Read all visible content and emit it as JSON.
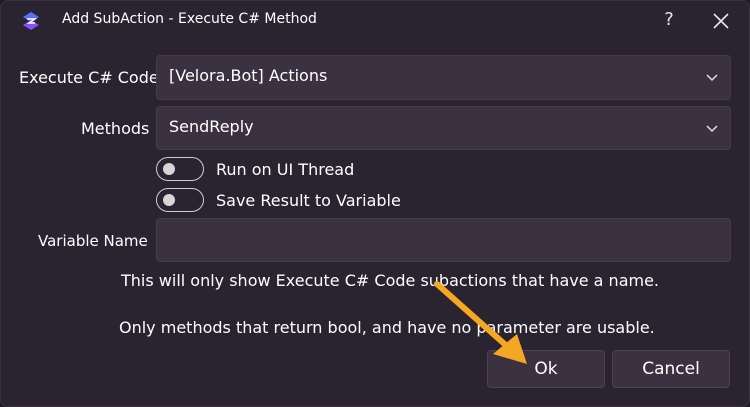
{
  "window": {
    "title": "Add SubAction - Execute C# Method",
    "help_label": "?"
  },
  "form": {
    "code_label": "Execute C# Code",
    "code_value": "[Velora.Bot] Actions",
    "methods_label": "Methods",
    "methods_value": "SendReply",
    "toggle_ui_thread": {
      "label": "Run on UI Thread",
      "on": false
    },
    "toggle_save_result": {
      "label": "Save Result to Variable",
      "on": false
    },
    "variable_label": "Variable Name",
    "variable_value": ""
  },
  "info": {
    "line1": "This will only show Execute C# Code subactions that have a name.",
    "line2": "Only methods that return bool, and have no parameter are usable."
  },
  "buttons": {
    "ok": "Ok",
    "cancel": "Cancel"
  },
  "colors": {
    "background": "#2a2330",
    "field": "#3a3240",
    "accent": "#4f6bff",
    "annotation_arrow": "#f5a623"
  }
}
